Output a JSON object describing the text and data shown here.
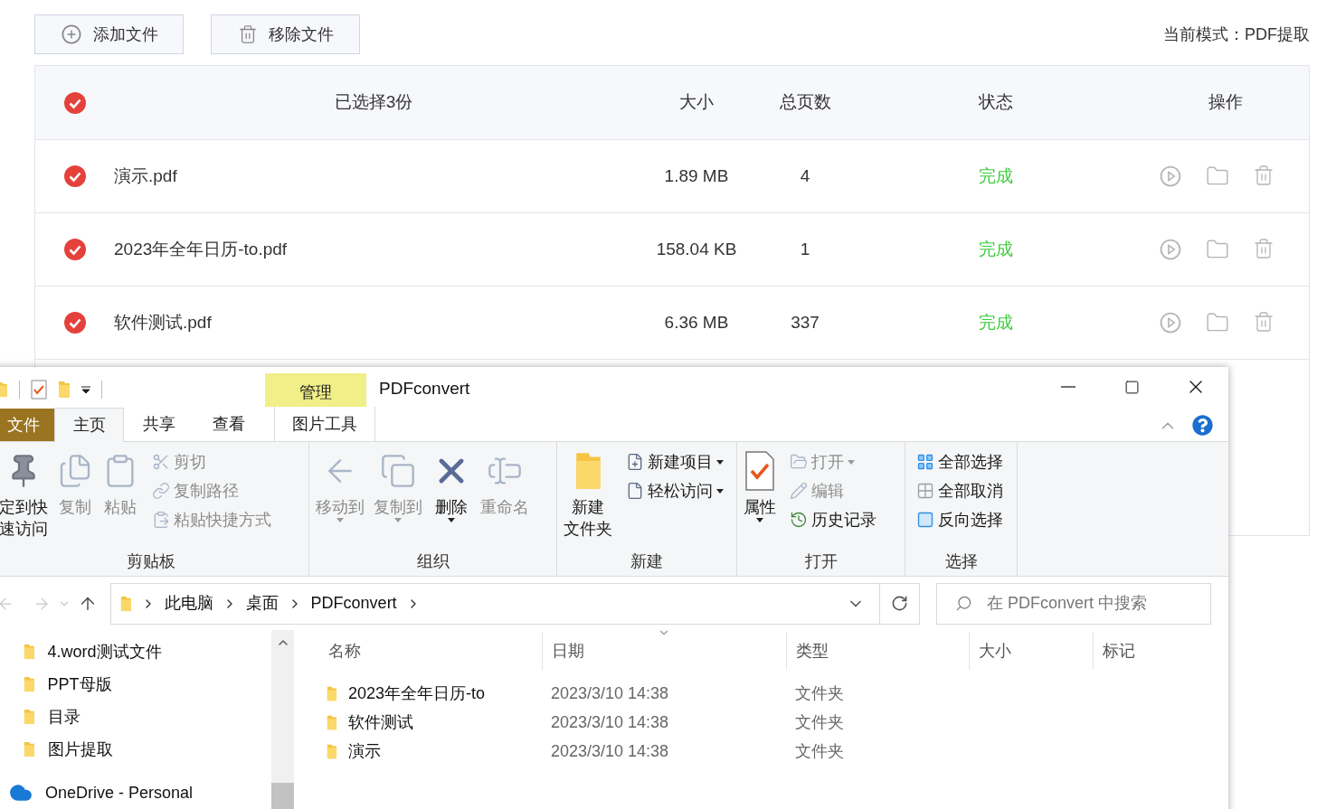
{
  "app": {
    "toolbar": [
      {
        "kind": "add",
        "label": "添加文件"
      },
      {
        "kind": "remove",
        "label": "移除文件"
      }
    ],
    "mode": "当前模式：PDF提取",
    "table": {
      "all_checked": true,
      "columns": [
        "已选择3份",
        "大小",
        "总页数",
        "状态",
        "操作"
      ],
      "rows": [
        {
          "checked": true,
          "name": "演示.pdf",
          "size": "1.89 MB",
          "pages": "4",
          "status": "完成"
        },
        {
          "checked": true,
          "name": "2023年全年日历-to.pdf",
          "size": "158.04 KB",
          "pages": "1",
          "status": "完成"
        },
        {
          "checked": true,
          "name": "软件测试.pdf",
          "size": "6.36 MB",
          "pages": "337",
          "status": "完成"
        }
      ]
    }
  },
  "explorer": {
    "title": "PDFconvert",
    "context_tab": "管理",
    "tabs": [
      {
        "kind": "file",
        "label": "文件",
        "selected": false
      },
      {
        "kind": "tab",
        "label": "主页",
        "selected": true
      },
      {
        "kind": "tab",
        "label": "共享",
        "selected": false
      },
      {
        "kind": "tab",
        "label": "查看",
        "selected": false
      },
      {
        "kind": "context",
        "label": "图片工具",
        "selected": false
      }
    ],
    "ribbon": [
      {
        "label": "剪贴板",
        "items": [
          {
            "kind": "large",
            "lines": [
              "定到快",
              "速访问"
            ],
            "disabled": false,
            "dropdown": false
          },
          {
            "kind": "large",
            "lines": [
              "复制"
            ],
            "disabled": true,
            "dropdown": false
          },
          {
            "kind": "large",
            "lines": [
              "粘贴"
            ],
            "disabled": true,
            "dropdown": false
          },
          {
            "kind": "small",
            "label": "剪切",
            "disabled": true,
            "dropdown": false
          },
          {
            "kind": "small",
            "label": "复制路径",
            "disabled": true,
            "dropdown": false
          },
          {
            "kind": "small",
            "label": "粘贴快捷方式",
            "disabled": true,
            "dropdown": false
          }
        ]
      },
      {
        "label": "组织",
        "items": [
          {
            "kind": "large",
            "lines": [
              "移动到"
            ],
            "disabled": true,
            "dropdown": true
          },
          {
            "kind": "large",
            "lines": [
              "复制到"
            ],
            "disabled": true,
            "dropdown": true
          },
          {
            "kind": "large",
            "lines": [
              "删除"
            ],
            "disabled": false,
            "dropdown": true
          },
          {
            "kind": "large",
            "lines": [
              "重命名"
            ],
            "disabled": true,
            "dropdown": false
          }
        ]
      },
      {
        "label": "新建",
        "items": [
          {
            "kind": "large",
            "lines": [
              "新建",
              "文件夹"
            ],
            "disabled": false,
            "dropdown": false
          },
          {
            "kind": "small",
            "label": "新建项目",
            "disabled": false,
            "dropdown": true
          },
          {
            "kind": "small",
            "label": "轻松访问",
            "disabled": false,
            "dropdown": true
          }
        ]
      },
      {
        "label": "打开",
        "items": [
          {
            "kind": "large",
            "lines": [
              "属性"
            ],
            "disabled": false,
            "dropdown": true
          },
          {
            "kind": "small",
            "label": "打开",
            "disabled": true,
            "dropdown": true
          },
          {
            "kind": "small",
            "label": "编辑",
            "disabled": true,
            "dropdown": false
          },
          {
            "kind": "small",
            "label": "历史记录",
            "disabled": false,
            "dropdown": false
          }
        ]
      },
      {
        "label": "选择",
        "items": [
          {
            "kind": "small",
            "label": "全部选择",
            "disabled": false,
            "dropdown": false
          },
          {
            "kind": "small",
            "label": "全部取消",
            "disabled": false,
            "dropdown": false
          },
          {
            "kind": "small",
            "label": "反向选择",
            "disabled": false,
            "dropdown": false
          }
        ]
      }
    ],
    "crumbs": [
      "此电脑",
      "桌面",
      "PDFconvert"
    ],
    "search": {
      "placeholder": "在 PDFconvert 中搜索"
    },
    "nav": [
      {
        "kind": "folder",
        "label": "4.word测试文件"
      },
      {
        "kind": "folder",
        "label": "PPT母版"
      },
      {
        "kind": "folder",
        "label": "目录"
      },
      {
        "kind": "folder",
        "label": "图片提取"
      },
      {
        "kind": "cloud",
        "label": "OneDrive - Personal"
      }
    ],
    "columns": [
      "名称",
      "日期",
      "类型",
      "大小",
      "标记"
    ],
    "files": [
      {
        "name": "2023年全年日历-to",
        "date": "2023/3/10 14:38",
        "type": "文件夹"
      },
      {
        "name": "软件测试",
        "date": "2023/3/10 14:38",
        "type": "文件夹"
      },
      {
        "name": "演示",
        "date": "2023/3/10 14:38",
        "type": "文件夹"
      }
    ]
  }
}
